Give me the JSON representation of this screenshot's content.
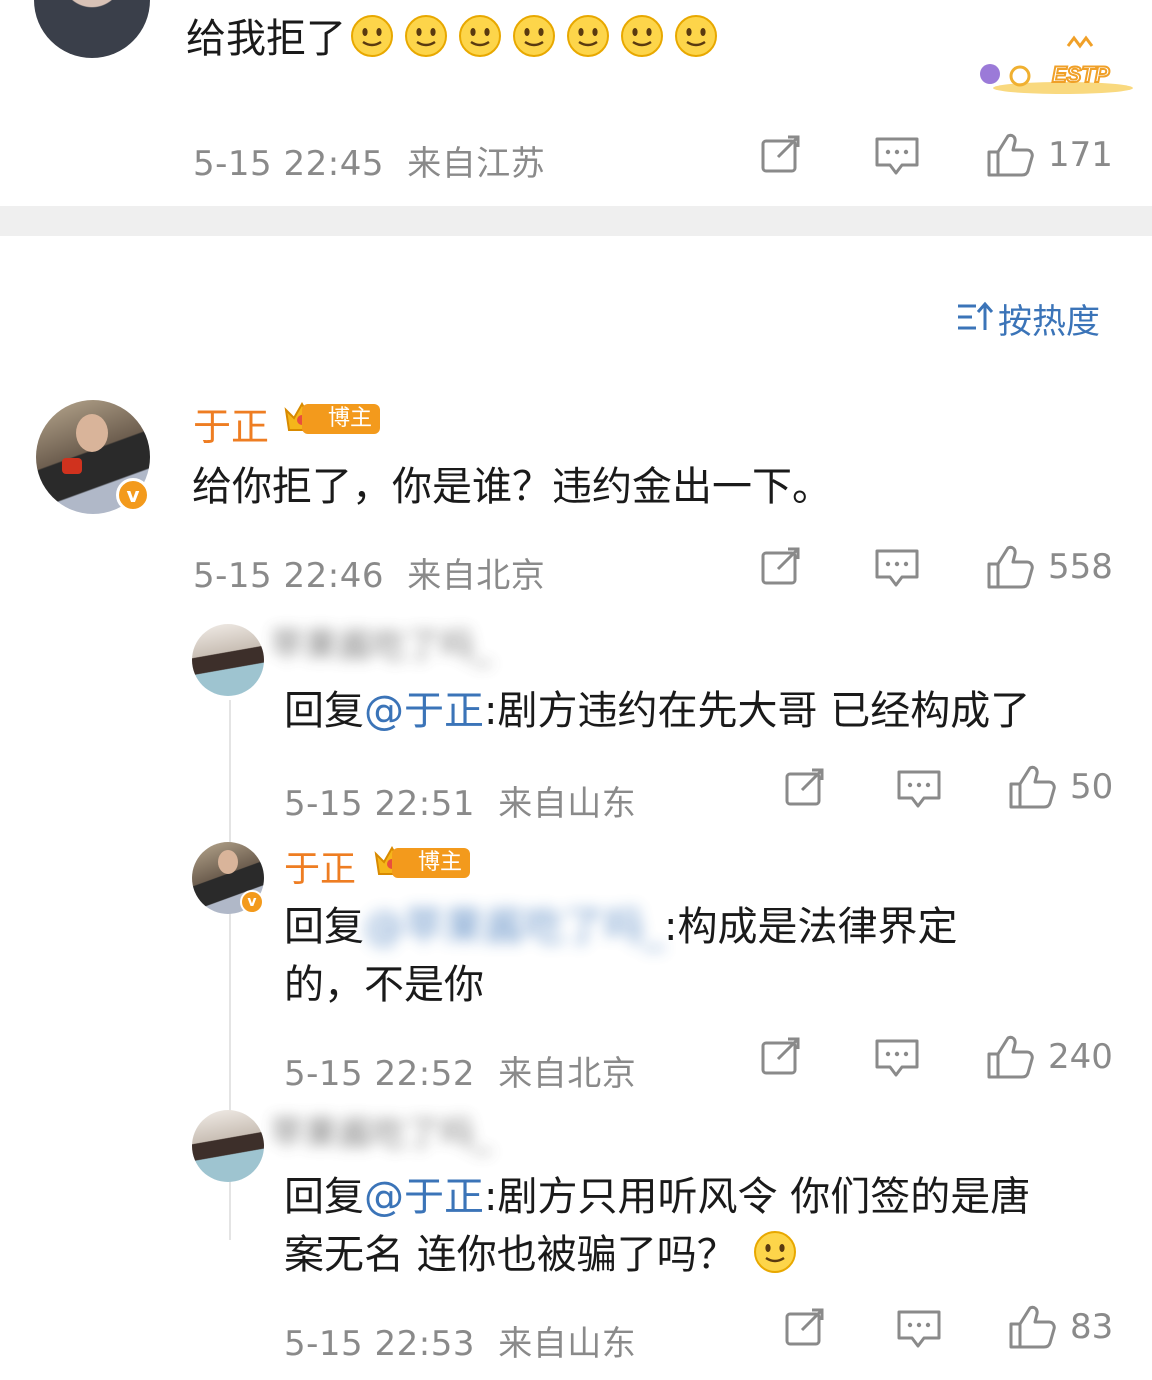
{
  "top_comment": {
    "text": "给我拒了",
    "emoji_count": 7,
    "time": "5-15 22:45",
    "location": "来自江苏",
    "likes": "171",
    "sticker_text": "ESTP"
  },
  "sort_label": "按热度",
  "comment": {
    "user": "于正",
    "badge": "博主",
    "text": "给你拒了，你是谁？违约金出一下。",
    "time": "5-15 22:46",
    "location": "来自北京",
    "likes": "558"
  },
  "replies": [
    {
      "user": "苹果酱吃了吗_",
      "prefix": "回复",
      "mention": "@于正",
      "text": ":剧方违约在先大哥 已经构成了",
      "time": "5-15 22:51",
      "location": "来自山东",
      "likes": "50"
    },
    {
      "user": "于正",
      "badge": "博主",
      "prefix": "回复",
      "mention": "@苹果酱吃了吗_",
      "text_line1": ":构成是法律界定",
      "text_line2": "的，不是你",
      "time": "5-15 22:52",
      "location": "来自北京",
      "likes": "240"
    },
    {
      "user": "苹果酱吃了吗_",
      "prefix": "回复",
      "mention": "@于正",
      "text_line1": ":剧方只用听风令 你们签的是唐",
      "text_line2": "案无名 连你也被骗了吗？",
      "time": "5-15 22:53",
      "location": "来自山东",
      "likes": "83"
    }
  ],
  "colors": {
    "username": "#ee7d22",
    "mention": "#3b74b8",
    "meta": "#8a8a8a",
    "divider": "#efefef",
    "badge": "#f39a1c"
  }
}
